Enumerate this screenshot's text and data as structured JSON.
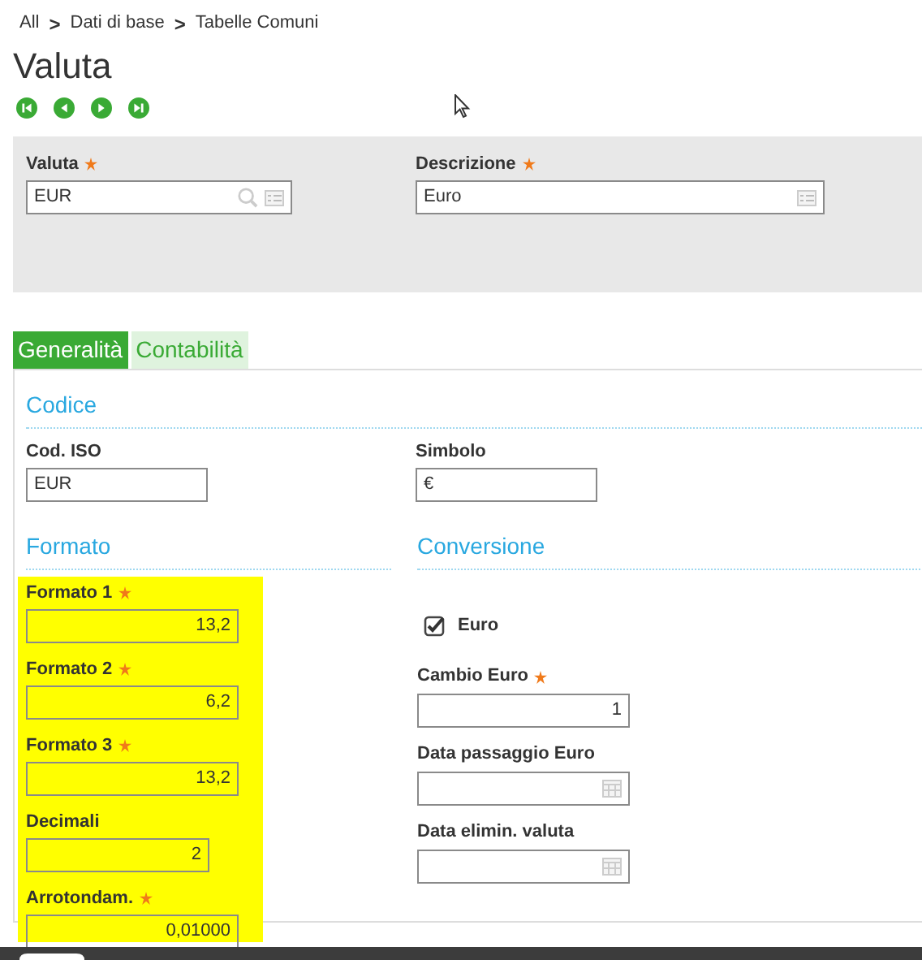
{
  "breadcrumb": [
    {
      "kind": "link",
      "text": "All"
    },
    {
      "kind": "separator",
      "text": ">"
    },
    {
      "kind": "link",
      "text": "Dati di base"
    },
    {
      "kind": "separator",
      "text": ">"
    },
    {
      "kind": "link",
      "text": "Tabelle Comuni"
    }
  ],
  "title": "Valuta",
  "header_fields": [
    {
      "label": "Valuta",
      "required": true,
      "value": "EUR",
      "kind": "lookup"
    },
    {
      "label": "Descrizione",
      "required": true,
      "value": "Euro",
      "kind": "memo"
    }
  ],
  "tabs": [
    {
      "label": "Generalità",
      "selected": true
    },
    {
      "label": "Contabilità",
      "selected": false
    }
  ],
  "codice": {
    "title": "Codice",
    "fields": [
      {
        "label": "Cod. ISO",
        "required": false,
        "value": "EUR",
        "kind": "text"
      },
      {
        "label": "Simbolo",
        "required": false,
        "value": "€",
        "kind": "text"
      }
    ]
  },
  "formato": {
    "title": "Formato",
    "highlighted": true,
    "fields": [
      {
        "label": "Formato 1",
        "required": true,
        "value": "13,2",
        "kind": "number"
      },
      {
        "label": "Formato 2",
        "required": true,
        "value": "6,2",
        "kind": "number"
      },
      {
        "label": "Formato 3",
        "required": true,
        "value": "13,2",
        "kind": "number"
      },
      {
        "label": "Decimali",
        "required": false,
        "value": "2",
        "kind": "number"
      },
      {
        "label": "Arrotondam.",
        "required": true,
        "value": "0,01000",
        "kind": "number"
      }
    ]
  },
  "conversione": {
    "title": "Conversione",
    "items": [
      {
        "kind": "checkbox",
        "label": "Euro",
        "checked": true
      },
      {
        "kind": "number",
        "label": "Cambio Euro",
        "required": true,
        "value": "1"
      },
      {
        "kind": "date",
        "label": "Data passaggio Euro",
        "required": false
      },
      {
        "kind": "date",
        "label": "Data elimin. valuta",
        "required": false
      }
    ]
  }
}
